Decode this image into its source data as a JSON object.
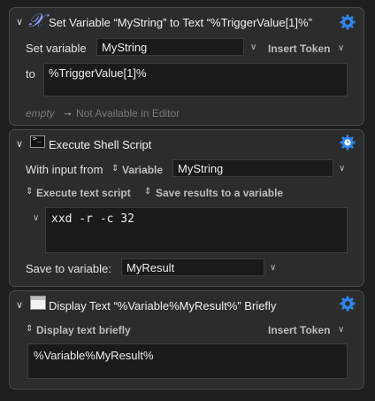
{
  "colors": {
    "background": "#1e1e1e",
    "panel": "#2c2c2c",
    "field": "#1a1a1a",
    "gear_blue": "#2f86e8"
  },
  "action1": {
    "title": "Set Variable “MyString” to Text “%TriggerValue[1]%”",
    "icon": "variable-x-icon",
    "set_variable_label": "Set variable",
    "variable_name": "MyString",
    "insert_token": "Insert Token",
    "to_label": "to",
    "to_value": "%TriggerValue[1]%",
    "empty_label": "empty",
    "not_available": "Not Available in Editor"
  },
  "action2": {
    "title": "Execute Shell Script",
    "icon": "terminal-icon",
    "with_input_label": "With input from",
    "input_source": "Variable",
    "input_variable": "MyString",
    "execute_mode": "Execute text script",
    "save_mode": "Save results to a variable",
    "script": "xxd -r -c 32",
    "save_to_label": "Save to variable:",
    "save_to_value": "MyResult"
  },
  "action3": {
    "title": "Display Text “%Variable%MyResult%” Briefly",
    "icon": "window-icon",
    "display_mode": "Display text briefly",
    "insert_token": "Insert Token",
    "text_value": "%Variable%MyResult%"
  }
}
